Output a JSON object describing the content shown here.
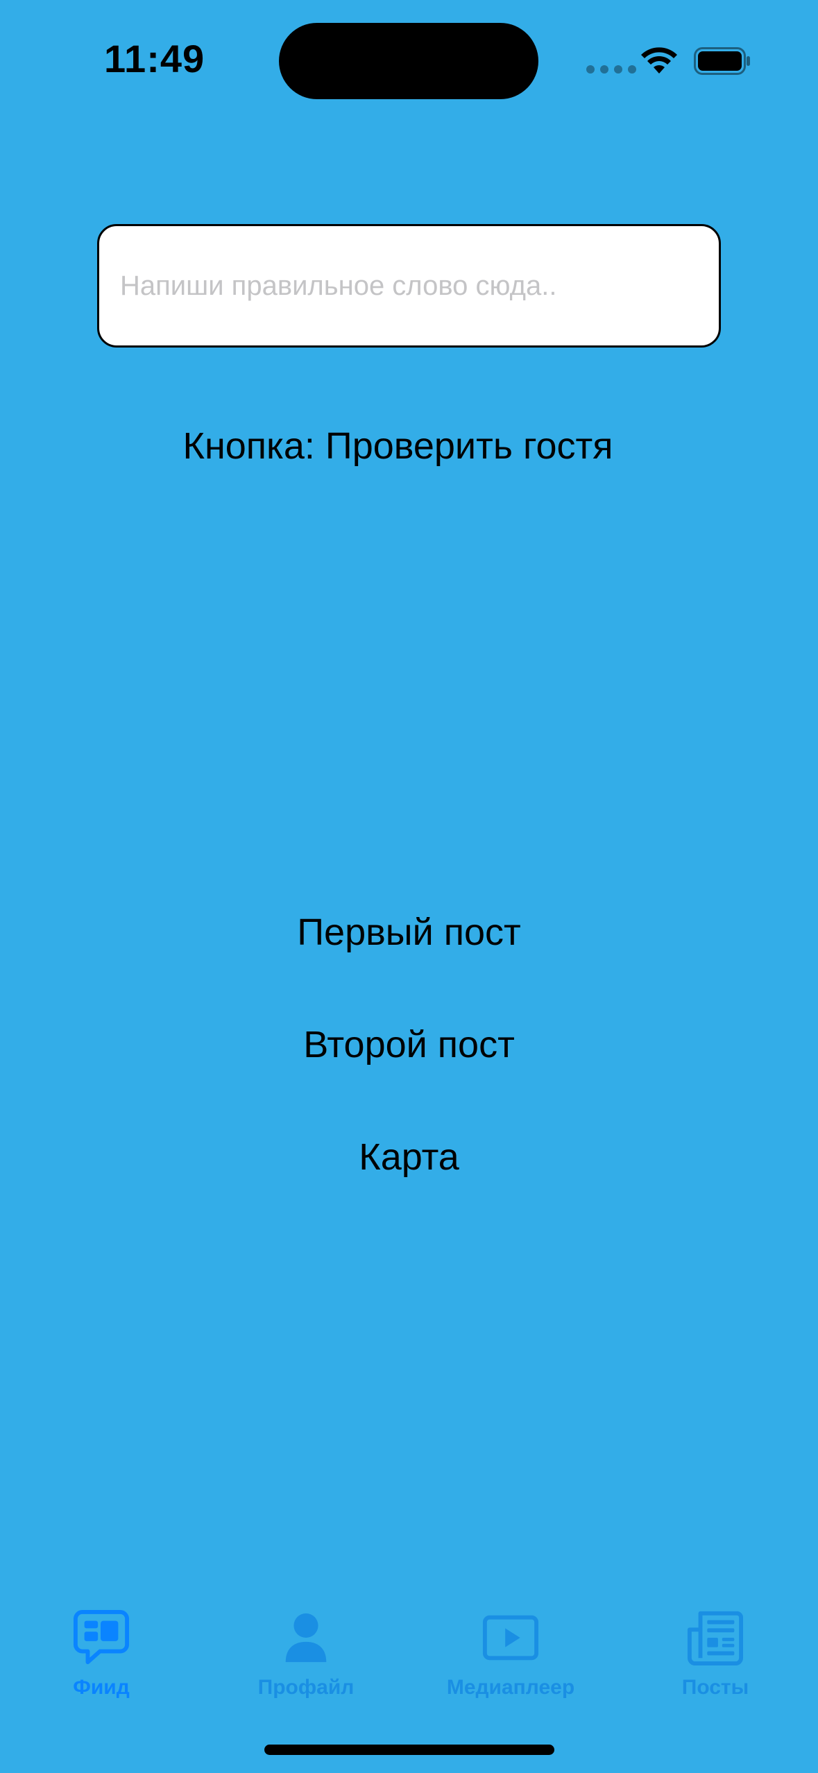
{
  "status_bar": {
    "time": "11:49"
  },
  "input": {
    "placeholder": "Напиши правильное слово сюда..",
    "value": ""
  },
  "buttons": {
    "check_guest": "Кнопка: Проверить гостя",
    "first_post": "Первый пост",
    "second_post": "Второй пост",
    "map": "Карта"
  },
  "tab_bar": {
    "tabs": [
      {
        "label": "Фиид",
        "icon": "feed-bubble-icon",
        "active": true
      },
      {
        "label": "Профайл",
        "icon": "person-icon",
        "active": false
      },
      {
        "label": "Медиаплеер",
        "icon": "play-rectangle-icon",
        "active": false
      },
      {
        "label": "Посты",
        "icon": "newspaper-icon",
        "active": false
      }
    ]
  },
  "colors": {
    "background": "#33ADE8",
    "tab_active": "#0A84FF",
    "tab_inactive": "#1A8FE3",
    "placeholder": "#C4C4C6"
  }
}
